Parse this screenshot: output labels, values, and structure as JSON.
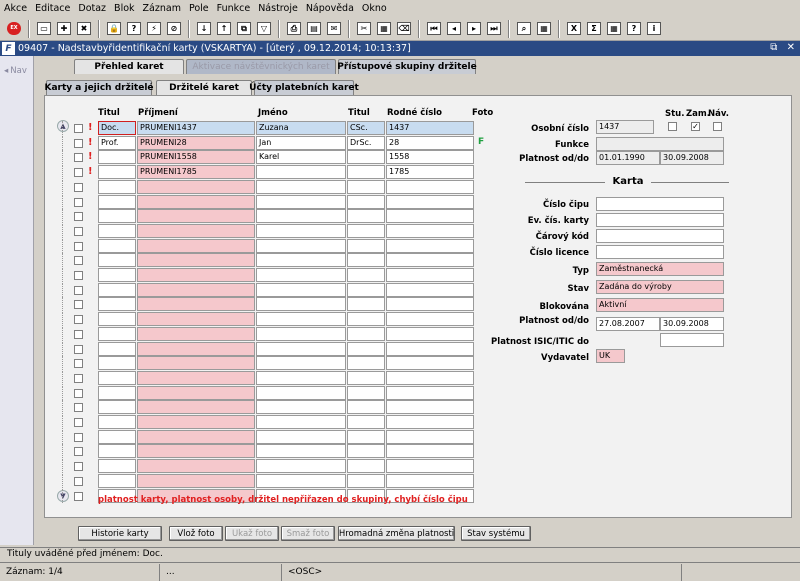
{
  "menu": [
    "Akce",
    "Editace",
    "Dotaz",
    "Blok",
    "Záznam",
    "Pole",
    "Funkce",
    "Nástroje",
    "Nápověda",
    "Okno"
  ],
  "toolbar_icons": [
    "exit-icon",
    "save-icon",
    "new-record-icon",
    "delete-record-icon",
    "lock-icon",
    "query-icon",
    "execute-query-icon",
    "cancel-query-icon",
    "sort-asc-icon",
    "sort-desc-icon",
    "copy-icon",
    "filter-icon",
    "print-icon",
    "print-preview-icon",
    "mail-icon",
    "cut-icon",
    "paste-icon",
    "clear-icon",
    "first-record-icon",
    "prev-record-icon",
    "next-record-icon",
    "last-record-icon",
    "lookup-icon",
    "table-view-icon",
    "excel-export-icon",
    "sum-icon",
    "calendar-icon",
    "help-icon",
    "info-icon"
  ],
  "window": {
    "title": "09407 - Nadstavbyřidentifikační karty (VSKARTYA) - [úterý  , 09.12.2014; 10:13:37]",
    "logo": "F",
    "controls": "⧉ ✕"
  },
  "nav_label": "Nav",
  "tabs_top": [
    "Přehled karet",
    "Aktivace návštěvnických karet",
    "Přístupové skupiny držitele"
  ],
  "tabs_sub": [
    "Karty a jejich držitelé",
    "Držitelé karet",
    "Účty platebních karet"
  ],
  "columns": {
    "titul": "Titul",
    "prijmeni": "Příjmení",
    "jmeno": "Jméno",
    "titul2": "Titul",
    "rc": "Rodné číslo",
    "foto": "Foto"
  },
  "rows": [
    {
      "titul": "Doc.",
      "prijmeni": "PRUMENI1437",
      "jmeno": "Zuzana",
      "titul2": "CSc.",
      "rc": "1437",
      "foto": ""
    },
    {
      "titul": "Prof.",
      "prijmeni": "PRUMENI28",
      "jmeno": "Jan",
      "titul2": "DrSc.",
      "rc": "28",
      "foto": "F"
    },
    {
      "titul": "",
      "prijmeni": "PRUMENI1558",
      "jmeno": "Karel",
      "titul2": "",
      "rc": "1558",
      "foto": ""
    },
    {
      "titul": "",
      "prijmeni": "PRUMENI1785",
      "jmeno": "",
      "titul2": "",
      "rc": "1785",
      "foto": ""
    }
  ],
  "empty_row_count": 22,
  "detail": {
    "flags": {
      "stu": "Stu.",
      "zam": "Zam.",
      "nav": "Náv."
    },
    "osobni_cislo_label": "Osobní číslo",
    "osobni_cislo": "1437",
    "funkce_label": "Funkce",
    "funkce": "",
    "platnost_label": "Platnost od/do",
    "platnost_od": "01.01.1990",
    "platnost_do": "30.09.2008",
    "karta_heading": "Karta",
    "cislo_cipu_label": "Číslo čipu",
    "ev_cis_label": "Ev. čís. karty",
    "carovy_kod_label": "Čárový kód",
    "cislo_licence_label": "Číslo licence",
    "typ_label": "Typ",
    "typ": "Zaměstnanecká",
    "stav_label": "Stav",
    "stav": "Zadána do výroby",
    "blokovana_label": "Blokována",
    "blokovana": "Aktivní",
    "karta_platnost_label": "Platnost od/do",
    "karta_od": "27.08.2007",
    "karta_do": "30.09.2008",
    "isic_label": "Platnost ISIC/ITIC do",
    "vydavatel_label": "Vydavatel",
    "vydavatel": "UK"
  },
  "error_message": "platnost karty, platnost osoby, držitel nepřiřazen do skupiny, chybí číslo čipu",
  "buttons": [
    "Historie karty",
    "Vlož foto",
    "Ukaž foto",
    "Smaž foto",
    "Hromadná změna platnosti",
    "Stav systému"
  ],
  "status_line": "Tituly uváděné před jménem: Doc.",
  "status_record": "Záznam: 1/4",
  "status_ellipsis": "...",
  "status_mode": "<OSC>"
}
